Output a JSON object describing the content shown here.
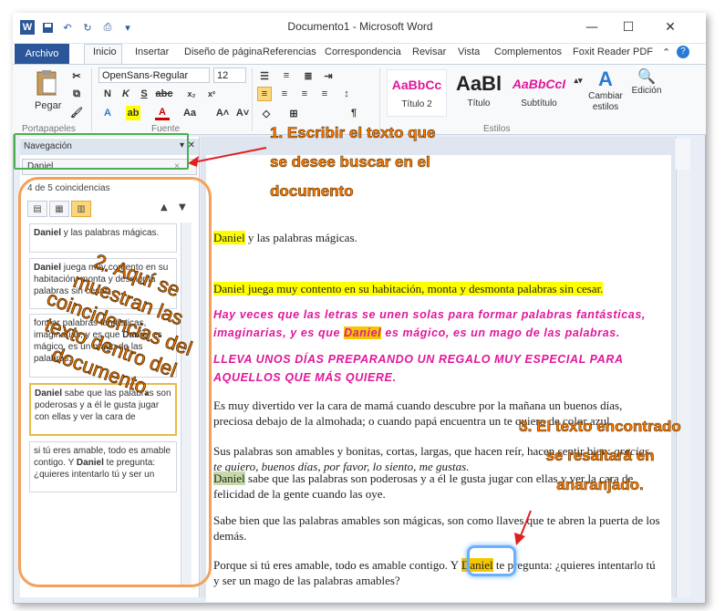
{
  "window": {
    "title": "Documento1 - Microsoft Word",
    "minimize": "—",
    "maximize": "☐",
    "close": "✕"
  },
  "qat": {
    "app": "W",
    "save": "💾",
    "undo": "↶",
    "redo": "↻"
  },
  "tabs": {
    "file": "Archivo",
    "items": [
      "Inicio",
      "Insertar",
      "Diseño de página",
      "Referencias",
      "Correspondencia",
      "Revisar",
      "Vista",
      "Complementos",
      "Foxit Reader PDF"
    ]
  },
  "ribbon": {
    "paste": "Pegar",
    "font_name": "OpenSans-Regular",
    "font_size": "12",
    "groups": {
      "clipboard": "Portapapeles",
      "font": "Fuente",
      "styles": "Estilos"
    },
    "styles": [
      {
        "sample": "AaBbCc",
        "name": "Título 2"
      },
      {
        "sample": "AaBl",
        "name": "Título"
      },
      {
        "sample": "AaBbCcI",
        "name": "Subtítulo"
      }
    ],
    "change_styles": "Cambiar estilos",
    "edit": "Edición"
  },
  "nav": {
    "title": "Navegación",
    "search": "Daniel",
    "count": "4 de 5 coincidencias",
    "results": [
      {
        "bold": "Daniel",
        "text": " y las palabras mágicas."
      },
      {
        "bold": "Daniel",
        "text": " juega muy contento en su habitación, monta y desmonta palabras sin cesar."
      },
      {
        "bold": "",
        "text": "formar palabras fantásticas, imaginarias, y es que ",
        "bold2": "Daniel",
        "text2": " es mágico, es un mago de las palabras."
      },
      {
        "bold": "Daniel",
        "text": " sabe que las palabras son poderosas y a él le gusta jugar con ellas y ver la cara de"
      },
      {
        "bold": "",
        "text": "si tú eres amable, todo es amable contigo. Y ",
        "bold2": "Daniel",
        "text2": " te pregunta: ¿quieres intentarlo tú y ser un"
      }
    ]
  },
  "doc": {
    "p1_hl": "Daniel",
    "p1": " y las palabras mágicas.",
    "p2": "Daniel juega muy contento en su habitación, monta y desmonta palabras sin cesar.",
    "p3a": "Hay veces que las letras se unen solas para formar palabras fantásticas, imaginarias, y es que ",
    "p3_hl": "Daniel",
    "p3b": " es mágico, es un mago de las palabras.",
    "p4": "LLEVA UNOS DÍAS PREPARANDO UN REGALO MUY ESPECIAL PARA AQUELLOS QUE MÁS QUIERE.",
    "p5": "Es muy divertido ver la cara de mamá cuando descubre por la mañana un buenos días, preciosa debajo de la almohada; o cuando papá encuentra un te quiero de color azul.",
    "p6a": "Sus palabras son amables y bonitas, cortas, largas, que hacen reír, hacen sentir bien: ",
    "p6i": "gracias, te quiero, buenos días, por favor, lo siento, me gustas.",
    "p7_hl": "Daniel",
    "p7": " sabe que las palabras son poderosas y a él le gusta jugar con ellas y ver la cara de felicidad de la gente cuando las oye.",
    "p8": "Sabe bien que las palabras amables son mágicas, son como llaves que te abren la puerta de los demás.",
    "p9a": "Porque si tú eres amable, todo es amable contigo. Y ",
    "p9_hl": "Daniel",
    "p9b": " te pregunta: ¿quieres intentarlo tú y ser un mago de las palabras amables?"
  },
  "annotations": {
    "a1": [
      "1. Escribir el texto que",
      "se desee buscar en el",
      "documento"
    ],
    "a2": "2. Aquí se muestran las coincidencias del texto dentro del documento.",
    "a3": [
      "3. El texto encontrado",
      "se resaltará en",
      "anaranjado."
    ]
  }
}
